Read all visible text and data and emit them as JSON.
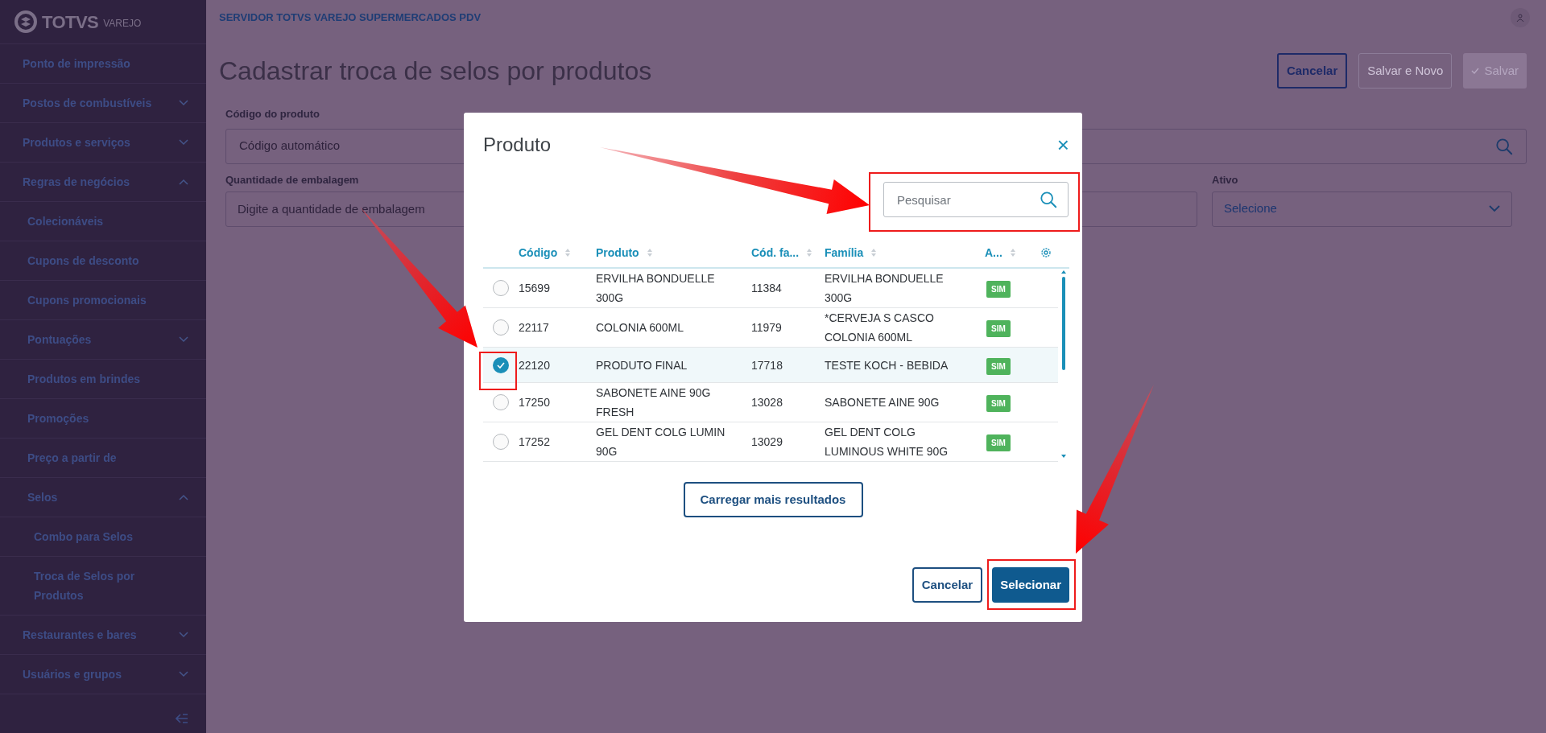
{
  "sidebar": {
    "logo": {
      "brand": "TOTVS",
      "product": "VAREJO"
    },
    "items": [
      {
        "kind": "link",
        "label": "Ponto de impressão"
      },
      {
        "kind": "group",
        "label": "Postos de combustíveis",
        "expanded": false
      },
      {
        "kind": "group",
        "label": "Produtos e serviços",
        "expanded": false
      },
      {
        "kind": "group",
        "label": "Regras de negócios",
        "expanded": true,
        "children": [
          {
            "kind": "link",
            "label": "Colecionáveis"
          },
          {
            "kind": "link",
            "label": "Cupons de desconto"
          },
          {
            "kind": "link",
            "label": "Cupons promocionais"
          },
          {
            "kind": "group",
            "label": "Pontuações",
            "expanded": false
          },
          {
            "kind": "link",
            "label": "Produtos em brindes"
          },
          {
            "kind": "link",
            "label": "Promoções"
          },
          {
            "kind": "link",
            "label": "Preço a partir de"
          },
          {
            "kind": "group",
            "label": "Selos",
            "expanded": true,
            "children": [
              {
                "kind": "link",
                "label": "Combo para Selos"
              },
              {
                "kind": "link",
                "label": "Troca de Selos por Produtos"
              }
            ]
          }
        ]
      },
      {
        "kind": "group",
        "label": "Restaurantes e bares",
        "expanded": false
      },
      {
        "kind": "group",
        "label": "Usuários e grupos",
        "expanded": false
      }
    ]
  },
  "header": {
    "server": "SERVIDOR TOTVS VAREJO SUPERMERCADOS PDV"
  },
  "page": {
    "title": "Cadastrar troca de selos por produtos",
    "buttons": [
      {
        "label": "Cancelar",
        "kind": "outline"
      },
      {
        "label": "Salvar e Novo",
        "kind": "disabled"
      },
      {
        "label": "Salvar",
        "kind": "primary-disabled"
      }
    ],
    "fields": [
      {
        "label": "Código do produto",
        "placeholder": "Código automático",
        "kind": "search"
      },
      {
        "label": "Quantidade de embalagem",
        "placeholder": "Digite a quantidade de embalagem",
        "kind": "text"
      },
      {
        "kind": "text"
      },
      {
        "label": "Ativo",
        "placeholder": "Selecione",
        "kind": "select"
      }
    ]
  },
  "modal": {
    "title": "Produto",
    "close": "×",
    "search": {
      "placeholder": "Pesquisar"
    },
    "columns": [
      "Código",
      "Produto",
      "Cód. fa...",
      "Família",
      "A..."
    ],
    "rows": [
      {
        "selected": false,
        "cells": [
          "15699",
          "ERVILHA BONDUELLE 300G",
          "11384",
          "ERVILHA BONDUELLE 300G"
        ],
        "active": "SIM"
      },
      {
        "selected": false,
        "cells": [
          "22117",
          "COLONIA 600ML",
          "11979",
          "*CERVEJA S CASCO COLONIA 600ML"
        ],
        "active": "SIM"
      },
      {
        "selected": true,
        "cells": [
          "22120",
          "PRODUTO FINAL",
          "17718",
          "TESTE KOCH - BEBIDA"
        ],
        "active": "SIM"
      },
      {
        "selected": false,
        "cells": [
          "17250",
          "SABONETE AINE 90G FRESH",
          "13028",
          "SABONETE AINE 90G"
        ],
        "active": "SIM"
      },
      {
        "selected": false,
        "cells": [
          "17252",
          "GEL DENT COLG LUMIN 90G",
          "13029",
          "GEL DENT COLG LUMINOUS WHITE 90G"
        ],
        "active": "SIM"
      }
    ],
    "load_more": "Carregar mais resultados",
    "footer_buttons": [
      {
        "label": "Cancelar",
        "kind": "outline"
      },
      {
        "label": "Selecionar",
        "kind": "primary"
      }
    ]
  }
}
